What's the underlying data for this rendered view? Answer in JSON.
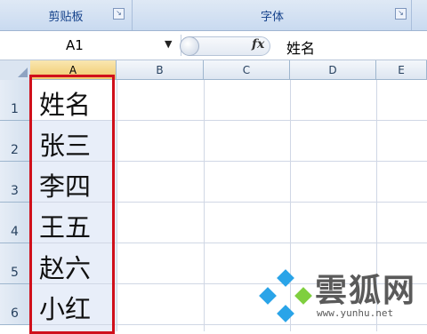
{
  "ribbon": {
    "group1_label": "剪贴板",
    "group2_label": "字体",
    "launcher_glyph": "↘"
  },
  "formula_bar": {
    "name_box": "A1",
    "dropdown_glyph": "▼",
    "fx_label": "fx",
    "content": "姓名"
  },
  "columns": [
    "A",
    "B",
    "C",
    "D",
    "E"
  ],
  "rows": [
    "1",
    "2",
    "3",
    "4",
    "5",
    "6"
  ],
  "cells_A": [
    "姓名",
    "张三",
    "李四",
    "王五",
    "赵六",
    "小红"
  ],
  "watermark": {
    "text": "雲狐网",
    "url": "www.yunhu.net",
    "logo_color": "#2aa4e8"
  },
  "colors": {
    "highlight_border": "#d0101b"
  }
}
